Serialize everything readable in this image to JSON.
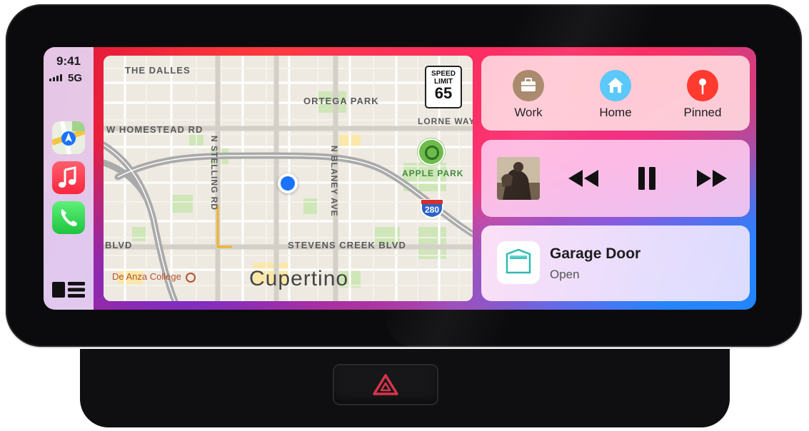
{
  "status": {
    "time": "9:41",
    "network": "5G"
  },
  "dock": {
    "apps": [
      {
        "name": "Maps",
        "icon": "maps-icon"
      },
      {
        "name": "Music",
        "icon": "music-icon"
      },
      {
        "name": "Phone",
        "icon": "phone-icon"
      }
    ],
    "dashboard_icon": "dashboard-icon"
  },
  "map": {
    "city": "Cupertino",
    "labels": {
      "the_dalles": "THE DALLES",
      "ortega_park": "ORTEGA PARK",
      "lorne_way": "LORNE WAY",
      "homestead": "W HOMESTEAD RD",
      "stelling": "N STELLING RD",
      "blaney": "N BLANEY AVE",
      "apple_park": "APPLE PARK",
      "stevens_creek": "STEVENS CREEK BLVD",
      "blvd": "BLVD",
      "de_anza": "De Anza College"
    },
    "speed_limit": {
      "title_line1": "SPEED",
      "title_line2": "LIMIT",
      "value": "65"
    },
    "highway_shield": "280"
  },
  "destinations": [
    {
      "label": "Work",
      "icon": "briefcase-icon",
      "color": "#a8876a"
    },
    {
      "label": "Home",
      "icon": "house-icon",
      "color": "#5ac8fa"
    },
    {
      "label": "Pinned",
      "icon": "pin-icon",
      "color": "#ff3b30"
    }
  ],
  "now_playing": {
    "controls": [
      "rewind-icon",
      "pause-icon",
      "fast-forward-icon"
    ]
  },
  "home_accessory": {
    "title": "Garage Door",
    "state": "Open"
  },
  "hardware": {
    "hazard_icon": "hazard-icon"
  }
}
